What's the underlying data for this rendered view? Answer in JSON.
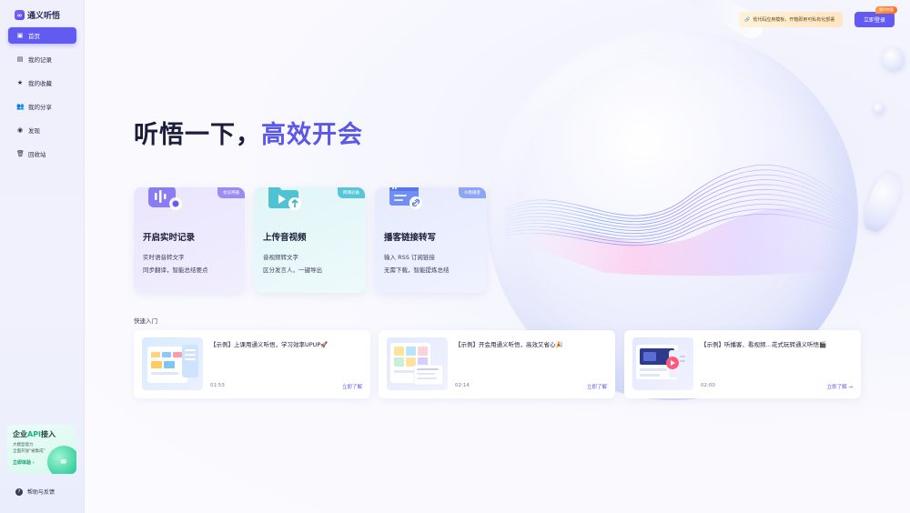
{
  "app": {
    "name": "通义听悟"
  },
  "sidebar": {
    "items": [
      {
        "label": "首页",
        "icon": "home-icon"
      },
      {
        "label": "我的记录",
        "icon": "file-icon"
      },
      {
        "label": "我的收藏",
        "icon": "star-icon"
      },
      {
        "label": "我的分享",
        "icon": "users-icon"
      },
      {
        "label": "发现",
        "icon": "podcast-icon"
      },
      {
        "label": "回收站",
        "icon": "trash-icon"
      }
    ],
    "api_card": {
      "title_a": "企业",
      "title_b": "API",
      "title_c": "接入",
      "line1": "大模型能力",
      "line2": "全面开放\"被集成\"",
      "button": "立即体验 ›"
    },
    "help": "帮助与反馈"
  },
  "header": {
    "promo": "低代码应用模板，开箱即用可私有化部署",
    "login": "立即登录",
    "limited_badge": "限时特惠"
  },
  "hero": {
    "headline_plain": "听悟一下，",
    "headline_accent": "高效开会"
  },
  "cards": [
    {
      "tag": "会议神器",
      "title": "开启实时记录",
      "line1": "实时语音转文字",
      "line2": "同步翻译，智能总结要点",
      "accent": "#9c8cf2"
    },
    {
      "tag": "网课必备",
      "title": "上传音视频",
      "line1": "音视频转文字",
      "line2": "区分发言人，一键导出",
      "accent": "#58c6d8"
    },
    {
      "tag": "AI看播客",
      "title": "播客链接转写",
      "line1": "输入 RSS 订阅链接",
      "line2": "无需下载，智能提炼总结",
      "accent": "#8ea4f5"
    }
  ],
  "quick": {
    "label": "快速入门",
    "items": [
      {
        "title": "【示例】上课用通义听悟，学习效率UPUP🚀",
        "time": "01:53",
        "link": "立即了解"
      },
      {
        "title": "【示例】开会用通义听悟，高效又省心🎉",
        "time": "02:14",
        "link": "立即了解"
      },
      {
        "title": "【示例】听播客、看视频…花式玩转通义听悟🎬",
        "time": "02:00",
        "link": "立即了解 →"
      }
    ]
  },
  "colors": {
    "brand": "#625bf2",
    "accent_text": "#5b58e8",
    "api_green": "#19b37e"
  }
}
